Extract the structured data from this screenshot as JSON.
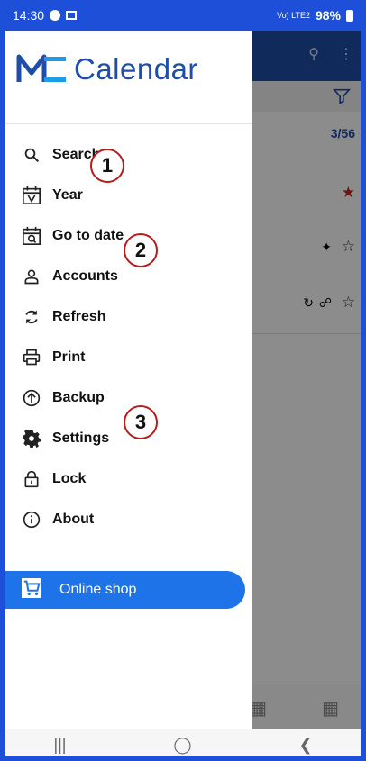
{
  "status_bar": {
    "time": "14:30",
    "battery": "98%",
    "signal_text": "Vo) LTE2"
  },
  "app_background": {
    "count": "3/56"
  },
  "drawer": {
    "brand": "Calendar",
    "items": [
      {
        "label": "Search",
        "icon": "search-icon"
      },
      {
        "label": "Year",
        "icon": "year-calendar-icon"
      },
      {
        "label": "Go to date",
        "icon": "go-to-date-icon"
      },
      {
        "label": "Accounts",
        "icon": "person-icon"
      },
      {
        "label": "Refresh",
        "icon": "refresh-icon"
      },
      {
        "label": "Print",
        "icon": "printer-icon"
      },
      {
        "label": "Backup",
        "icon": "upload-icon"
      },
      {
        "label": "Settings",
        "icon": "gear-icon"
      },
      {
        "label": "Lock",
        "icon": "lock-icon"
      },
      {
        "label": "About",
        "icon": "info-icon"
      }
    ],
    "shop_label": "Online shop"
  },
  "annotations": [
    "1",
    "2",
    "3"
  ],
  "colors": {
    "accent": "#1e73e8",
    "brand": "#1f4ea8",
    "frame": "#1d4fd8",
    "annotation_ring": "#b71c1c"
  }
}
